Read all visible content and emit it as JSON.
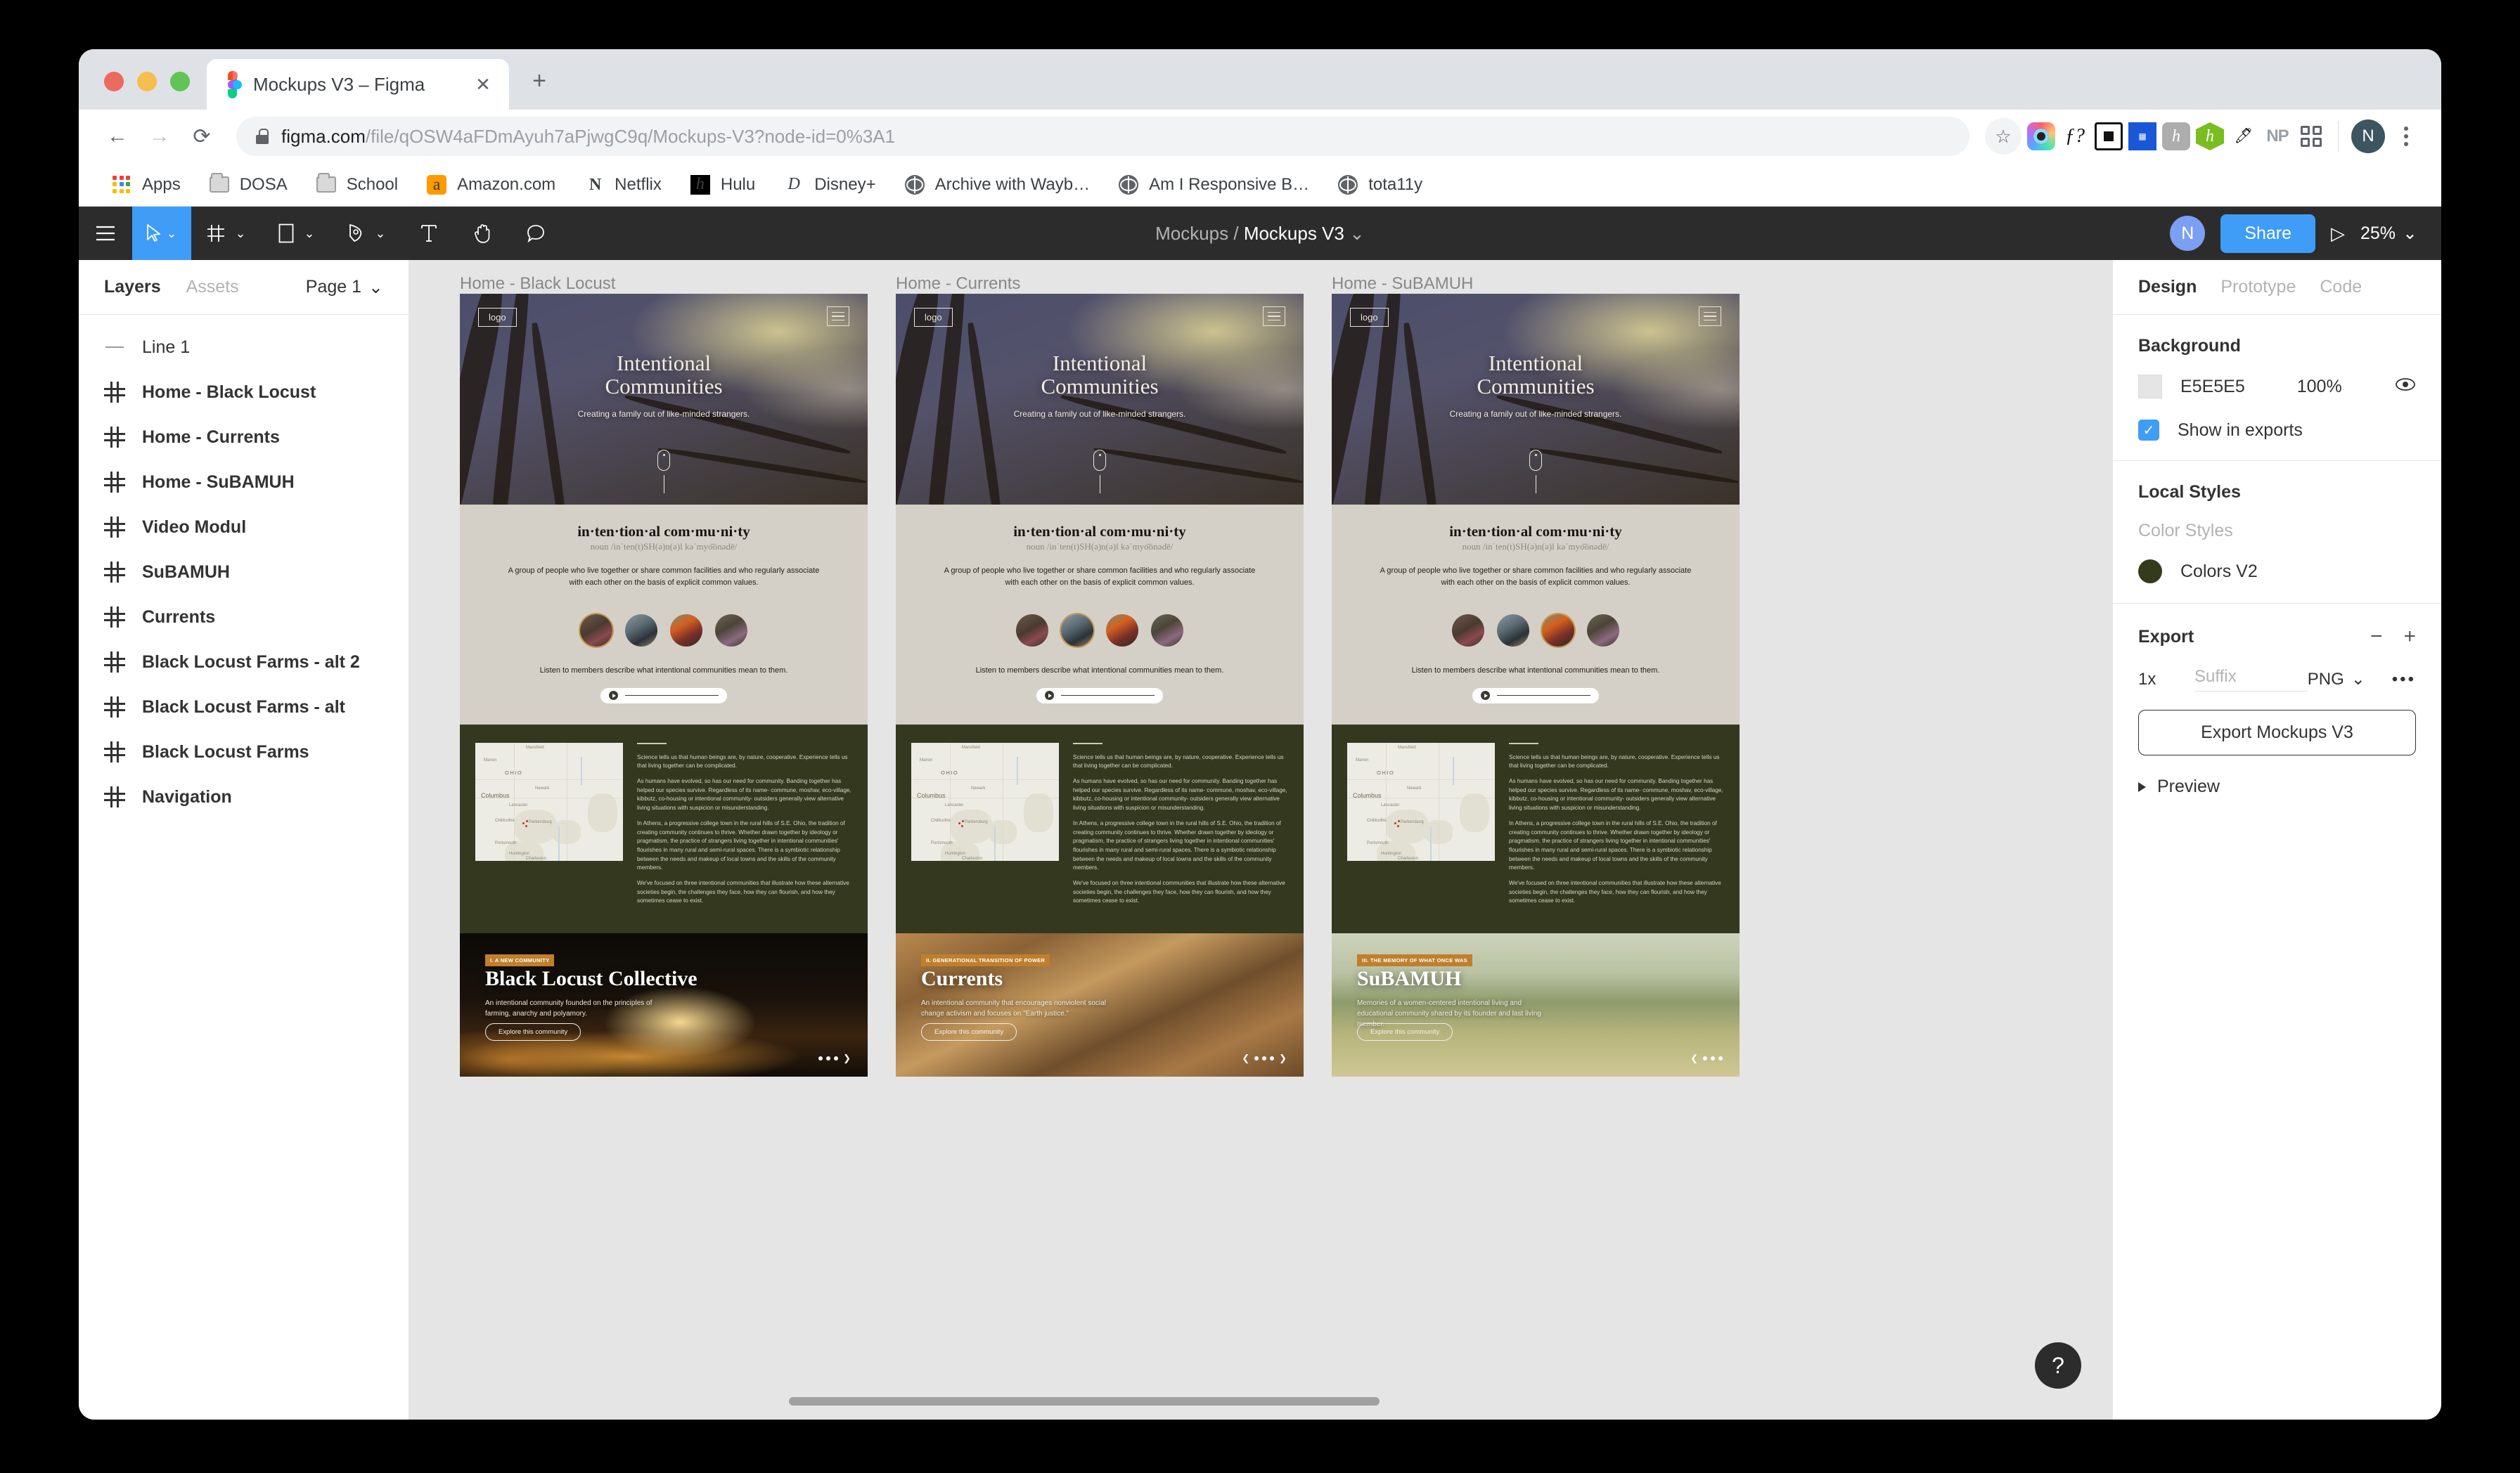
{
  "browser": {
    "tab_title": "Mockups V3 – Figma",
    "url_domain": "figma.com",
    "url_path": "/file/qOSW4aFDmAyuh7aPjwgC9q/Mockups-V3?node-id=0%3A1",
    "profile_initial": "N",
    "bookmarks": [
      {
        "label": "Apps",
        "icon": "apps-grid-icon"
      },
      {
        "label": "DOSA",
        "icon": "folder-icon"
      },
      {
        "label": "School",
        "icon": "folder-icon"
      },
      {
        "label": "Amazon.com",
        "icon": "amazon-icon"
      },
      {
        "label": "Netflix",
        "icon": "netflix-icon"
      },
      {
        "label": "Hulu",
        "icon": "hulu-icon"
      },
      {
        "label": "Disney+",
        "icon": "disney-icon"
      },
      {
        "label": "Archive with Wayb…",
        "icon": "globe-icon"
      },
      {
        "label": "Am I Responsive B…",
        "icon": "globe-icon"
      },
      {
        "label": "tota11y",
        "icon": "globe-icon"
      }
    ],
    "extensions": [
      "color-wheel-icon",
      "f-question-icon",
      "square-icon",
      "blue-block-icon",
      "h-script-icon",
      "hexagon-h-icon",
      "eyedropper-icon",
      "NP",
      "grid-apps-icon"
    ]
  },
  "figma_toolbar": {
    "menu_icon": "hamburger-menu-icon",
    "tools": [
      "move-tool",
      "frame-tool",
      "shape-tool",
      "pen-tool",
      "text-tool",
      "hand-tool",
      "comment-tool"
    ],
    "breadcrumb_project": "Mockups",
    "breadcrumb_file": "Mockups V3",
    "avatar_initial": "N",
    "share_label": "Share",
    "present_icon": "play-icon",
    "zoom_level": "25%"
  },
  "left_panel": {
    "tabs": [
      {
        "label": "Layers",
        "active": true
      },
      {
        "label": "Assets",
        "active": false
      }
    ],
    "page_selector": "Page 1",
    "layers": [
      {
        "name": "Line 1",
        "icon": "line-icon",
        "type": "line"
      },
      {
        "name": "Home - Black Locust",
        "icon": "frame-icon",
        "type": "frame"
      },
      {
        "name": "Home - Currents",
        "icon": "frame-icon",
        "type": "frame"
      },
      {
        "name": "Home - SuBAMUH",
        "icon": "frame-icon",
        "type": "frame"
      },
      {
        "name": "Video Modul",
        "icon": "frame-icon",
        "type": "frame"
      },
      {
        "name": "SuBAMUH",
        "icon": "frame-icon",
        "type": "frame"
      },
      {
        "name": "Currents",
        "icon": "frame-icon",
        "type": "frame"
      },
      {
        "name": "Black Locust Farms - alt 2",
        "icon": "frame-icon",
        "type": "frame"
      },
      {
        "name": "Black Locust Farms - alt",
        "icon": "frame-icon",
        "type": "frame"
      },
      {
        "name": "Black Locust Farms",
        "icon": "frame-icon",
        "type": "frame"
      },
      {
        "name": "Navigation",
        "icon": "frame-icon",
        "type": "frame"
      }
    ]
  },
  "right_panel": {
    "tabs": [
      {
        "label": "Design",
        "active": true
      },
      {
        "label": "Prototype",
        "active": false
      },
      {
        "label": "Code",
        "active": false
      }
    ],
    "background": {
      "heading": "Background",
      "hex": "E5E5E5",
      "opacity": "100%",
      "visibility_icon": "eye-icon",
      "show_in_exports_label": "Show in exports",
      "show_in_exports_checked": true
    },
    "local_styles": {
      "heading": "Local Styles",
      "sub_label": "Color Styles",
      "styles": [
        {
          "name": "Colors V2",
          "color": "#343a1c"
        }
      ]
    },
    "export": {
      "heading": "Export",
      "remove_icon": "minus-icon",
      "add_icon": "plus-icon",
      "scale": "1x",
      "suffix_placeholder": "Suffix",
      "format": "PNG",
      "more_icon": "ellipsis-icon",
      "button_label": "Export Mockups V3",
      "preview_label": "Preview"
    }
  },
  "canvas": {
    "background_color": "#E5E5E5",
    "help_icon": "question-mark-icon",
    "frames": [
      {
        "label": "Home - Black Locust",
        "hero": {
          "logo": "logo",
          "menu_icon": "hamburger-icon",
          "title_line1": "Intentional",
          "title_line2": "Communities",
          "subtitle": "Creating a family out of like-minded strangers.",
          "scroll_icon": "mouse-scroll-icon"
        },
        "definition": {
          "word": "in·ten·tion·al com·mu·ni·ty",
          "pronunciation": "noun /inˈten(t)SH(ə)n(ə)l  kəˈmyo͞onədē/",
          "body": "A group of people who live together or share common facilities and who regularly associate with each other on the basis of explicit common values.",
          "listen_caption": "Listen to members describe what intentional communities mean to them.",
          "player_icon": "play-icon",
          "avatar_count": 4,
          "selected_avatar": 1
        },
        "map_section": {
          "map_labels": [
            "Mansfield",
            "Marion",
            "OHIO",
            "Newark",
            "Columbus",
            "Lancaster",
            "Chillicothe",
            "Parkersburg",
            "Portsmouth",
            "Huntington",
            "Charleston"
          ],
          "paragraphs": [
            "Science tells us that human beings are, by nature, cooperative. Experience tells us that living together can be complicated.",
            "As humans have evolved, so has our need for community.  Banding together has helped our species survive. Regardless of its name- commune, moshav, eco-village, kibbutz, co-housing or  intentional community- outsiders generally view alternative living situations with suspicion or misunderstanding.",
            "In Athens, a progressive college town in the rural hills of S.E. Ohio, the tradition of creating community continues to thrive. Whether drawn together by ideology or pragmatism, the practice of strangers living together in intentional communities' flourishes in many rural and semi-rural spaces. There is a symbiotic relationship between the needs and makeup of local towns and the skills of the community members.",
            "We've focused on three intentional communities that illustrate how these alternative societies begin, the challenges they face, how they can flourish, and how they sometimes cease to exist."
          ]
        },
        "card": {
          "badge": "I. A NEW COMMUNITY",
          "heading": "Black Locust Collective",
          "body": "An intentional community founded on the principles of farming, anarchy and polyamory.",
          "cta": "Explore this community",
          "nav": {
            "prev": false,
            "dots": 3,
            "next": true
          }
        }
      },
      {
        "label": "Home - Currents",
        "hero": {
          "logo": "logo",
          "menu_icon": "hamburger-icon",
          "title_line1": "Intentional",
          "title_line2": "Communities",
          "subtitle": "Creating a family out of like-minded strangers.",
          "scroll_icon": "mouse-scroll-icon"
        },
        "definition": {
          "word": "in·ten·tion·al com·mu·ni·ty",
          "pronunciation": "noun /inˈten(t)SH(ə)n(ə)l  kəˈmyo͞onədē/",
          "body": "A group of people who live together or share common facilities and who regularly associate with each other on the basis of explicit common values.",
          "listen_caption": "Listen to members describe what intentional communities mean to them.",
          "player_icon": "play-icon",
          "avatar_count": 4,
          "selected_avatar": 2
        },
        "map_section": {
          "map_labels": [
            "Mansfield",
            "Marion",
            "OHIO",
            "Newark",
            "Columbus",
            "Lancaster",
            "Chillicothe",
            "Parkersburg",
            "Portsmouth",
            "Huntington",
            "Charleston"
          ],
          "paragraphs": [
            "Science tells us that human beings are, by nature, cooperative. Experience tells us that living together can be complicated.",
            "As humans have evolved, so has our need for community.  Banding together has helped our species survive. Regardless of its name- commune, moshav, eco-village, kibbutz, co-housing or  intentional community- outsiders generally view alternative living situations with suspicion or misunderstanding.",
            "In Athens, a progressive college town in the rural hills of S.E. Ohio, the tradition of creating community continues to thrive. Whether drawn together by ideology or pragmatism, the practice of strangers living together in intentional communities' flourishes in many rural and semi-rural spaces. There is a symbiotic relationship between the needs and makeup of local towns and the skills of the community members.",
            "We've focused on three intentional communities that illustrate how these alternative societies begin, the challenges they face, how they can flourish, and how they sometimes cease to exist."
          ]
        },
        "card": {
          "badge": "II. GENERATIONAL TRANSITION OF POWER",
          "heading": "Currents",
          "body": "An intentional community that encourages nonviolent social change activism and focuses on \"Earth justice.\"",
          "cta": "Explore this community",
          "nav": {
            "prev": true,
            "dots": 3,
            "next": true
          }
        }
      },
      {
        "label": "Home - SuBAMUH",
        "hero": {
          "logo": "logo",
          "menu_icon": "hamburger-icon",
          "title_line1": "Intentional",
          "title_line2": "Communities",
          "subtitle": "Creating a family out of like-minded strangers.",
          "scroll_icon": "mouse-scroll-icon"
        },
        "definition": {
          "word": "in·ten·tion·al com·mu·ni·ty",
          "pronunciation": "noun /inˈten(t)SH(ə)n(ə)l  kəˈmyo͞onədē/",
          "body": "A group of people who live together or share common facilities and who regularly associate with each other on the basis of explicit common values.",
          "listen_caption": "Listen to members describe what intentional communities mean to them.",
          "player_icon": "play-icon",
          "avatar_count": 4,
          "selected_avatar": 3
        },
        "map_section": {
          "map_labels": [
            "Mansfield",
            "Marion",
            "OHIO",
            "Newark",
            "Columbus",
            "Lancaster",
            "Chillicothe",
            "Parkersburg",
            "Portsmouth",
            "Huntington",
            "Charleston"
          ],
          "paragraphs": [
            "Science tells us that human beings are, by nature, cooperative. Experience tells us that living together can be complicated.",
            "As humans have evolved, so has our need for community.  Banding together has helped our species survive. Regardless of its name- commune, moshav, eco-village, kibbutz, co-housing or  intentional community- outsiders generally view alternative living situations with suspicion or misunderstanding.",
            "In Athens, a progressive college town in the rural hills of S.E. Ohio, the tradition of creating community continues to thrive. Whether drawn together by ideology or pragmatism, the practice of strangers living together in intentional communities' flourishes in many rural and semi-rural spaces. There is a symbiotic relationship between the needs and makeup of local towns and the skills of the community members.",
            "We've focused on three intentional communities that illustrate how these alternative societies begin, the challenges they face, how they can flourish, and how they sometimes cease to exist."
          ]
        },
        "card": {
          "badge": "III. THE MEMORY OF WHAT ONCE WAS",
          "heading": "SuBAMUH",
          "body": "Memories of a women-centered intentional living and educational community shared by its founder and last living member.",
          "cta": "Explore this community",
          "nav": {
            "prev": true,
            "dots": 3,
            "next": false
          }
        }
      }
    ]
  }
}
